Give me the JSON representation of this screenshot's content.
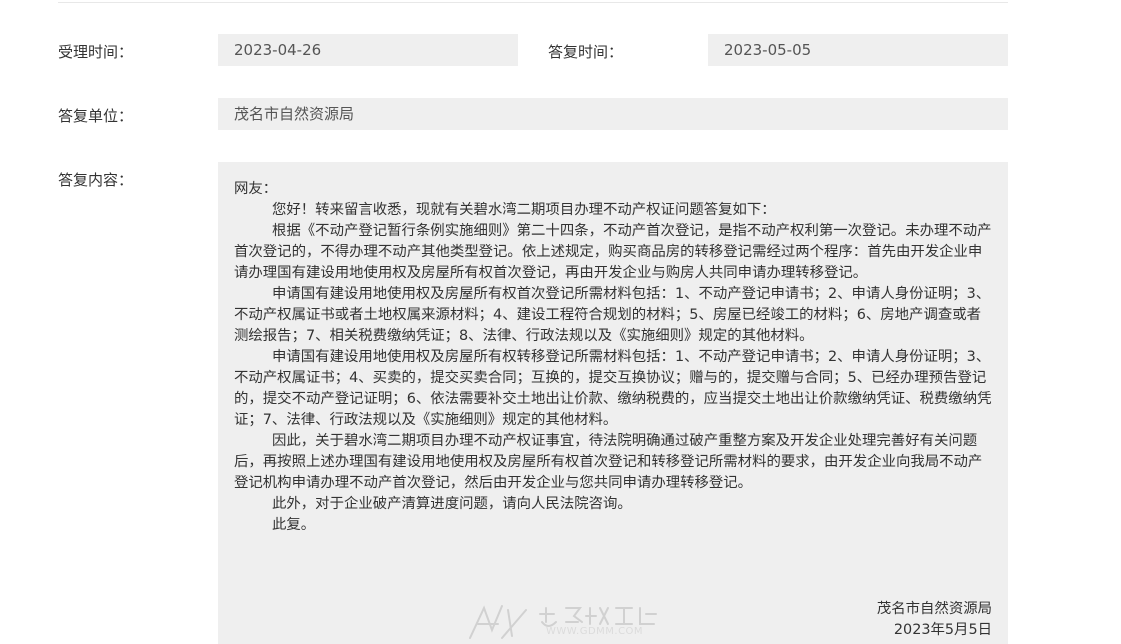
{
  "form": {
    "accept_time_label": "受理时间：",
    "accept_time_value": "2023-04-26",
    "reply_time_label": "答复时间：",
    "reply_time_value": "2023-05-05",
    "reply_unit_label": "答复单位：",
    "reply_unit_value": "茂名市自然资源局",
    "reply_content_label": "答复内容："
  },
  "reply": {
    "paragraphs": [
      "网友：",
      "您好！转来留言收悉，现就有关碧水湾二期项目办理不动产权证问题答复如下：",
      "根据《不动产登记暂行条例实施细则》第二十四条，不动产首次登记，是指不动产权利第一次登记。未办理不动产首次登记的，不得办理不动产其他类型登记。依上述规定，购买商品房的转移登记需经过两个程序：首先由开发企业申请办理国有建设用地使用权及房屋所有权首次登记，再由开发企业与购房人共同申请办理转移登记。",
      "申请国有建设用地使用权及房屋所有权首次登记所需材料包括：1、不动产登记申请书；2、申请人身份证明；3、不动产权属证书或者土地权属来源材料；4、建设工程符合规划的材料；5、房屋已经竣工的材料；6、房地产调查或者测绘报告；7、相关税费缴纳凭证；8、法律、行政法规以及《实施细则》规定的其他材料。",
      "申请国有建设用地使用权及房屋所有权转移登记所需材料包括：1、不动产登记申请书；2、申请人身份证明；3、不动产权属证书；4、买卖的，提交买卖合同；互换的，提交互换协议；赠与的，提交赠与合同；5、已经办理预告登记的，提交不动产登记证明；6、依法需要补交土地出让价款、缴纳税费的，应当提交土地出让价款缴纳凭证、税费缴纳凭证；7、法律、行政法规以及《实施细则》规定的其他材料。",
      "因此，关于碧水湾二期项目办理不动产权证事宜，待法院明确通过破产重整方案及开发企业处理完善好有关问题后，再按照上述办理国有建设用地使用权及房屋所有权首次登记和转移登记所需材料的要求，由开发企业向我局不动产登记机构申请办理不动产首次登记，然后由开发企业与您共同申请办理转移登记。",
      "此外，对于企业破产清算进度问题，请向人民法院咨询。",
      "此复。"
    ],
    "signature_org": "茂名市自然资源局",
    "signature_date": "2023年5月5日"
  },
  "watermark": {
    "url": "WWW.GDMM.COM"
  }
}
